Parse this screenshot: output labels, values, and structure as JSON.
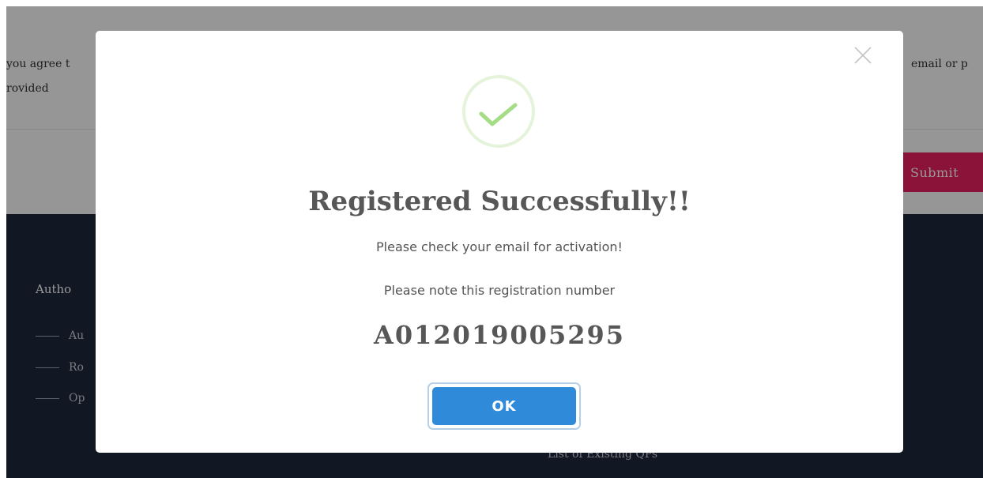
{
  "background": {
    "terms_line_1": "you agree t",
    "terms_line_2": "rovided",
    "terms_right": "email or p",
    "submit_label": "Submit",
    "footer": {
      "heading": "Autho",
      "links": [
        "Au",
        "Ro",
        "Op"
      ],
      "bottom_link": "List of Existing QPs"
    }
  },
  "modal": {
    "close_icon": "close-x-icon",
    "success_icon": "checkmark-circle-icon",
    "title": "Registered Successfully!!",
    "message_1": "Please check your email for activation!",
    "message_2": "Please note this registration number",
    "registration_number": "A012019005295",
    "ok_label": "OK"
  },
  "colors": {
    "overlay": "rgba(0,0,0,0.4)",
    "success_green": "#a5dc86",
    "ok_button": "#2f8ad9",
    "submit_button": "#e8215f",
    "footer_bg": "#1e283b"
  }
}
